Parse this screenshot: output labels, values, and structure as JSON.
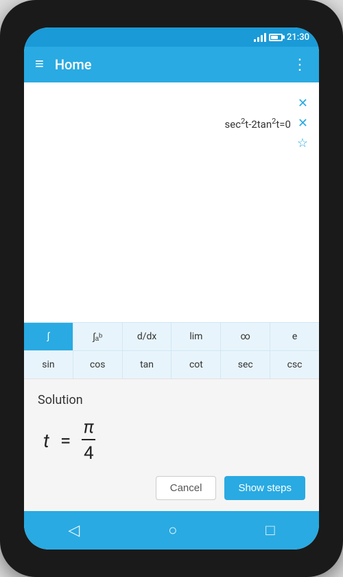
{
  "status_bar": {
    "time": "21:30"
  },
  "toolbar": {
    "title": "Home",
    "menu_label": "≡",
    "more_label": "⋮"
  },
  "equation_area": {
    "equation": "sec²t-2tan²t=0",
    "clear_label": "×",
    "close_label": "×",
    "star_label": "☆"
  },
  "keyboard": {
    "row1": [
      {
        "label": "∫",
        "active": false
      },
      {
        "label": "∫ₐᵇ",
        "active": false
      },
      {
        "label": "d/dx",
        "active": false
      },
      {
        "label": "lim",
        "active": false
      },
      {
        "label": "∞",
        "active": false
      },
      {
        "label": "e",
        "active": false
      }
    ],
    "row2": [
      {
        "label": "sin",
        "active": false
      },
      {
        "label": "cos",
        "active": false
      },
      {
        "label": "tan",
        "active": false
      },
      {
        "label": "cot",
        "active": false
      },
      {
        "label": "sec",
        "active": false
      },
      {
        "label": "csc",
        "active": false
      }
    ]
  },
  "solution": {
    "title": "Solution",
    "variable": "t",
    "equals": "=",
    "numerator": "π",
    "denominator": "4",
    "cancel_label": "Cancel",
    "show_steps_label": "Show steps"
  },
  "bottom_nav": {
    "back_label": "◁",
    "home_label": "○",
    "square_label": "□"
  }
}
